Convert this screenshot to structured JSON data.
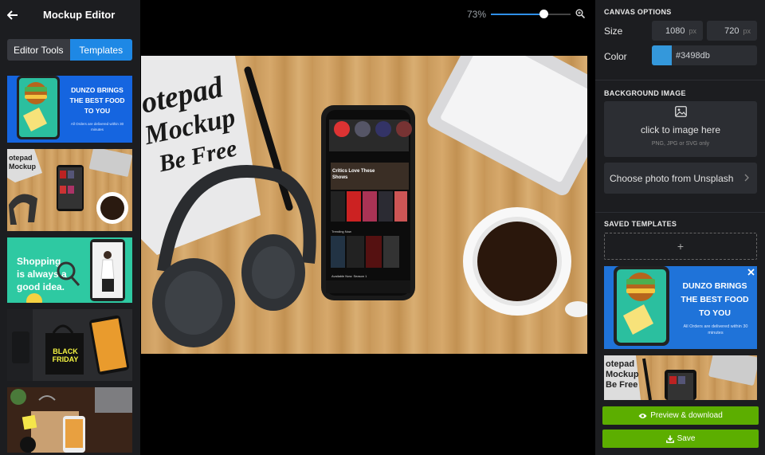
{
  "app": {
    "title": "Mockup Editor"
  },
  "sidebar": {
    "tabs": [
      {
        "label": "Editor Tools",
        "active": false
      },
      {
        "label": "Templates",
        "active": true
      }
    ],
    "templates": [
      {
        "title": "DUNZO BRINGS THE BEST FOOD TO YOU",
        "subtitle": "All Orders are delivered within 30 minutes"
      },
      {
        "title": ""
      },
      {
        "title": "Shopping is always a good idea."
      },
      {
        "title": "BLACK FRIDAY"
      },
      {
        "title": ""
      }
    ]
  },
  "zoom": {
    "label": "73%",
    "value": 73
  },
  "canvas": {
    "notepad_text": "otepad Mockup Be Free",
    "phone_show_title": "Critics Love These Shows",
    "phone_trending": "Trending Now",
    "phone_available": "Available Now: Season 1"
  },
  "canvas_options": {
    "section_title": "CANVAS OPTIONS",
    "size_label": "Size",
    "width": "1080",
    "height": "720",
    "unit": "px",
    "color_label": "Color",
    "color_value": "#3498db"
  },
  "background_image": {
    "section_title": "BACKGROUND IMAGE",
    "upload_text": "click to image here",
    "upload_hint": "PNG, JPG or SVG only",
    "unsplash_label": "Choose photo from Unsplash"
  },
  "saved_templates": {
    "section_title": "SAVED TEMPLATES",
    "add_label": "+",
    "items": [
      {
        "title": "DUNZO BRINGS THE BEST FOOD TO YOU",
        "subtitle": "All Orders are delivered within 30 minutes"
      }
    ]
  },
  "actions": {
    "preview_label": "Preview & download",
    "save_label": "Save"
  },
  "colors": {
    "accent": "#1e88e5",
    "green": "#5cae00",
    "panel": "#1c1d20",
    "input": "#2c2e33"
  }
}
